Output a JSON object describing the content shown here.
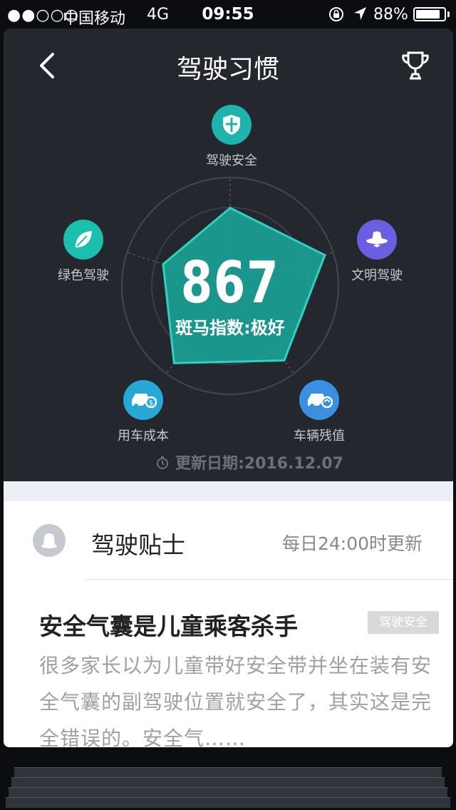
{
  "status": {
    "signal": "●●○○○",
    "carrier": "中国移动",
    "network": "4G",
    "time": "09:55",
    "battery": "88%",
    "battery_level": 0.88
  },
  "header": {
    "back_icon": "chevron-left-icon",
    "title": "驾驶习惯",
    "trophy_icon": "trophy-icon"
  },
  "radar": {
    "score": "867",
    "grade": "斑马指数:极好",
    "dimensions": [
      {
        "label": "驾驶安全",
        "icon": "shield-icon",
        "color": "#1fb3ae"
      },
      {
        "label": "文明驾驶",
        "icon": "hat-icon",
        "color": "#6a5fe0"
      },
      {
        "label": "车辆残值",
        "icon": "car-refresh-icon",
        "color": "#3b8fe0"
      },
      {
        "label": "用车成本",
        "icon": "car-dollar-icon",
        "color": "#27a7d6"
      },
      {
        "label": "绿色驾驶",
        "icon": "leaf-icon",
        "color": "#1bbfad"
      }
    ],
    "values": [
      0.72,
      0.92,
      0.85,
      0.88,
      0.65
    ],
    "fill_color": "#1aa397",
    "update_label": "更新日期:2016.12.07"
  },
  "tips": {
    "title": "驾驶贴士",
    "update_time": "每日24:00时更新",
    "article": {
      "title": "安全气囊是儿童乘客杀手",
      "tag": "驾驶安全",
      "body": "很多家长以为儿童带好安全带并坐在装有安全气囊的副驾驶位置就安全了，其实这是完全错误的。安全气……"
    }
  }
}
